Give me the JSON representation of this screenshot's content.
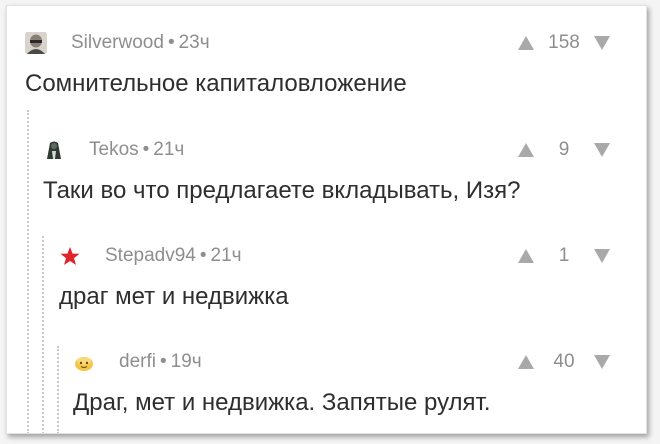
{
  "comments": [
    {
      "author": "Silverwood",
      "separator": "•",
      "time": "23ч",
      "text": "Сомнительное капиталовложение",
      "rating": "158",
      "avatar": "photo-avatar"
    },
    {
      "author": "Tekos",
      "separator": "•",
      "time": "21ч",
      "text": "Таки во что предлагаете вкладывать, Изя?",
      "rating": "9",
      "avatar": "dark-figure-avatar"
    },
    {
      "author": "Stepadv94",
      "separator": "•",
      "time": "21ч",
      "text": "драг мет и недвижка",
      "rating": "1",
      "avatar": "red-star-icon"
    },
    {
      "author": "derfi",
      "separator": "•",
      "time": "19ч",
      "text": "Драг, мет и недвижка. Запятые рулят.",
      "rating": "40",
      "avatar": "emoji-face-avatar"
    }
  ],
  "colors": {
    "meta": "#8e8e8e",
    "text": "#2e2e2e",
    "vote_arrow": "#a9a9a9",
    "star": "#e0242a"
  }
}
